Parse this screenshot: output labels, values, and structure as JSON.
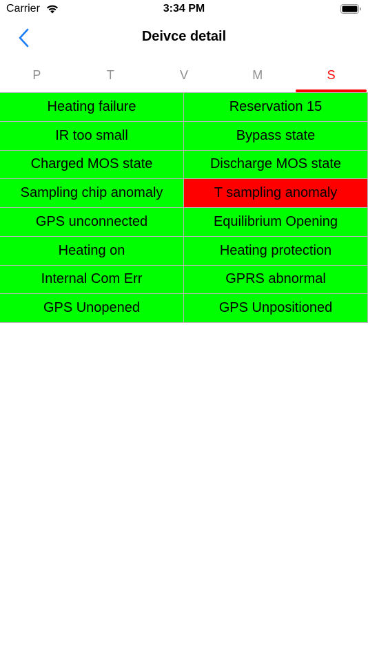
{
  "status_bar": {
    "carrier": "Carrier",
    "time": "3:34 PM"
  },
  "nav": {
    "title": "Deivce detail"
  },
  "tabs": [
    {
      "label": "P",
      "active": false
    },
    {
      "label": "T",
      "active": false
    },
    {
      "label": "V",
      "active": false
    },
    {
      "label": "M",
      "active": false
    },
    {
      "label": "S",
      "active": true
    }
  ],
  "colors": {
    "ok": "#00ff00",
    "alarm": "#ff0000",
    "active_tab": "#ff0000",
    "inactive_tab": "#8e8e8e",
    "back_icon": "#1a7cf5"
  },
  "status_cells": [
    {
      "label": "Heating failure",
      "state": "ok"
    },
    {
      "label": "Reservation 15",
      "state": "ok"
    },
    {
      "label": "IR too small",
      "state": "ok"
    },
    {
      "label": "Bypass state",
      "state": "ok"
    },
    {
      "label": "Charged MOS state",
      "state": "ok"
    },
    {
      "label": "Discharge MOS state",
      "state": "ok"
    },
    {
      "label": "Sampling chip anomaly",
      "state": "ok"
    },
    {
      "label": "T sampling anomaly",
      "state": "alarm"
    },
    {
      "label": "GPS unconnected",
      "state": "ok"
    },
    {
      "label": "Equilibrium Opening",
      "state": "ok"
    },
    {
      "label": "Heating on",
      "state": "ok"
    },
    {
      "label": "Heating protection",
      "state": "ok"
    },
    {
      "label": "Internal Com Err",
      "state": "ok"
    },
    {
      "label": "GPRS abnormal",
      "state": "ok"
    },
    {
      "label": "GPS Unopened",
      "state": "ok"
    },
    {
      "label": "GPS Unpositioned",
      "state": "ok"
    }
  ]
}
